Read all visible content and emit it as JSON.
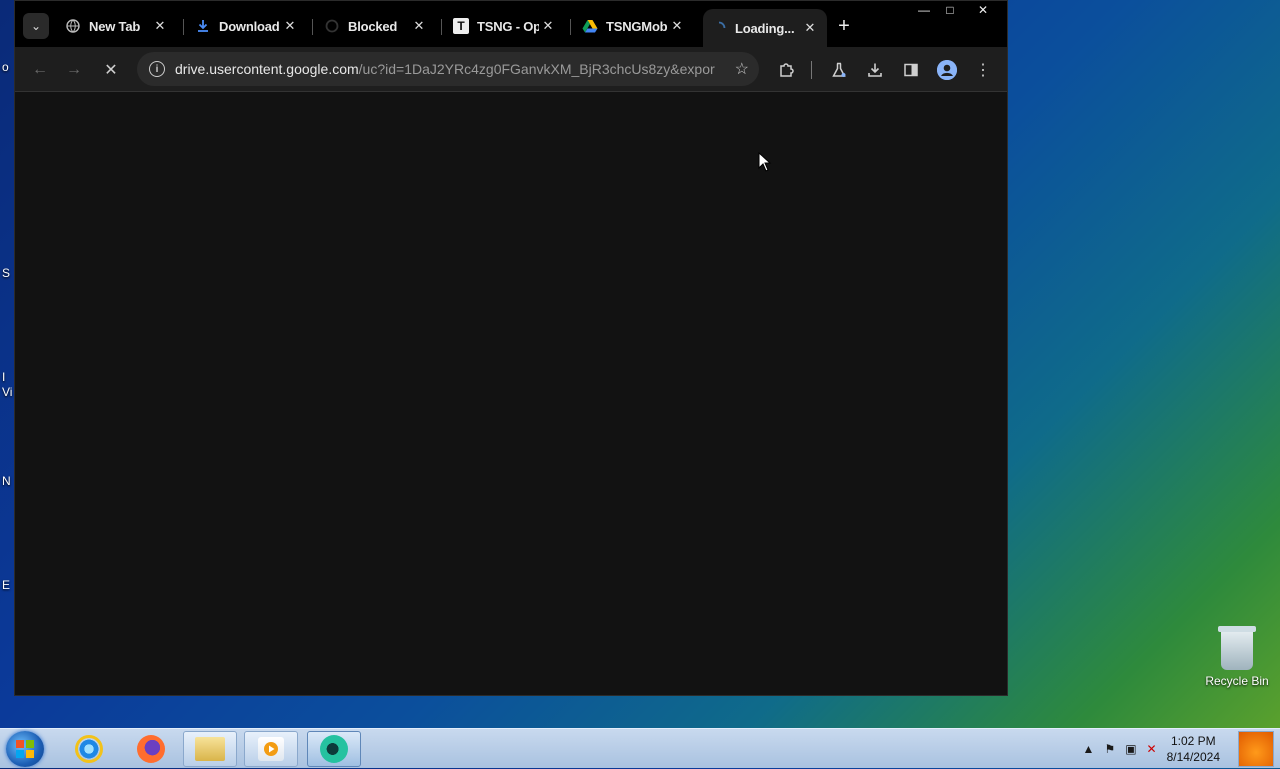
{
  "desktop": {
    "fragments": [
      "S",
      "Vi",
      "N",
      "E"
    ],
    "recycle_bin_label": "Recycle Bin"
  },
  "browser": {
    "tabs": [
      {
        "title": "New Tab",
        "icon": "globe-icon"
      },
      {
        "title": "Download",
        "icon": "download-icon"
      },
      {
        "title": "Blocked",
        "icon": "spinner-icon"
      },
      {
        "title": "TSNG - Op",
        "icon": "t-logo-icon"
      },
      {
        "title": "TSNGMob",
        "icon": "google-drive-icon"
      },
      {
        "title": "Loading...",
        "icon": "loading-spinner-icon"
      }
    ],
    "window_controls": {
      "minimize": "—",
      "maximize": "□",
      "close": "✕"
    },
    "address": {
      "host": "drive.usercontent.google.com",
      "path": "/uc?id=1DaJ2YRc4zg0FGanvkXM_BjR3chcUs8zy&export..."
    }
  },
  "taskbar": {
    "apps": [
      "internet-explorer",
      "firefox",
      "file-explorer",
      "media-player",
      "browser-active"
    ],
    "clock_time": "1:02 PM",
    "clock_date": "8/14/2024"
  }
}
